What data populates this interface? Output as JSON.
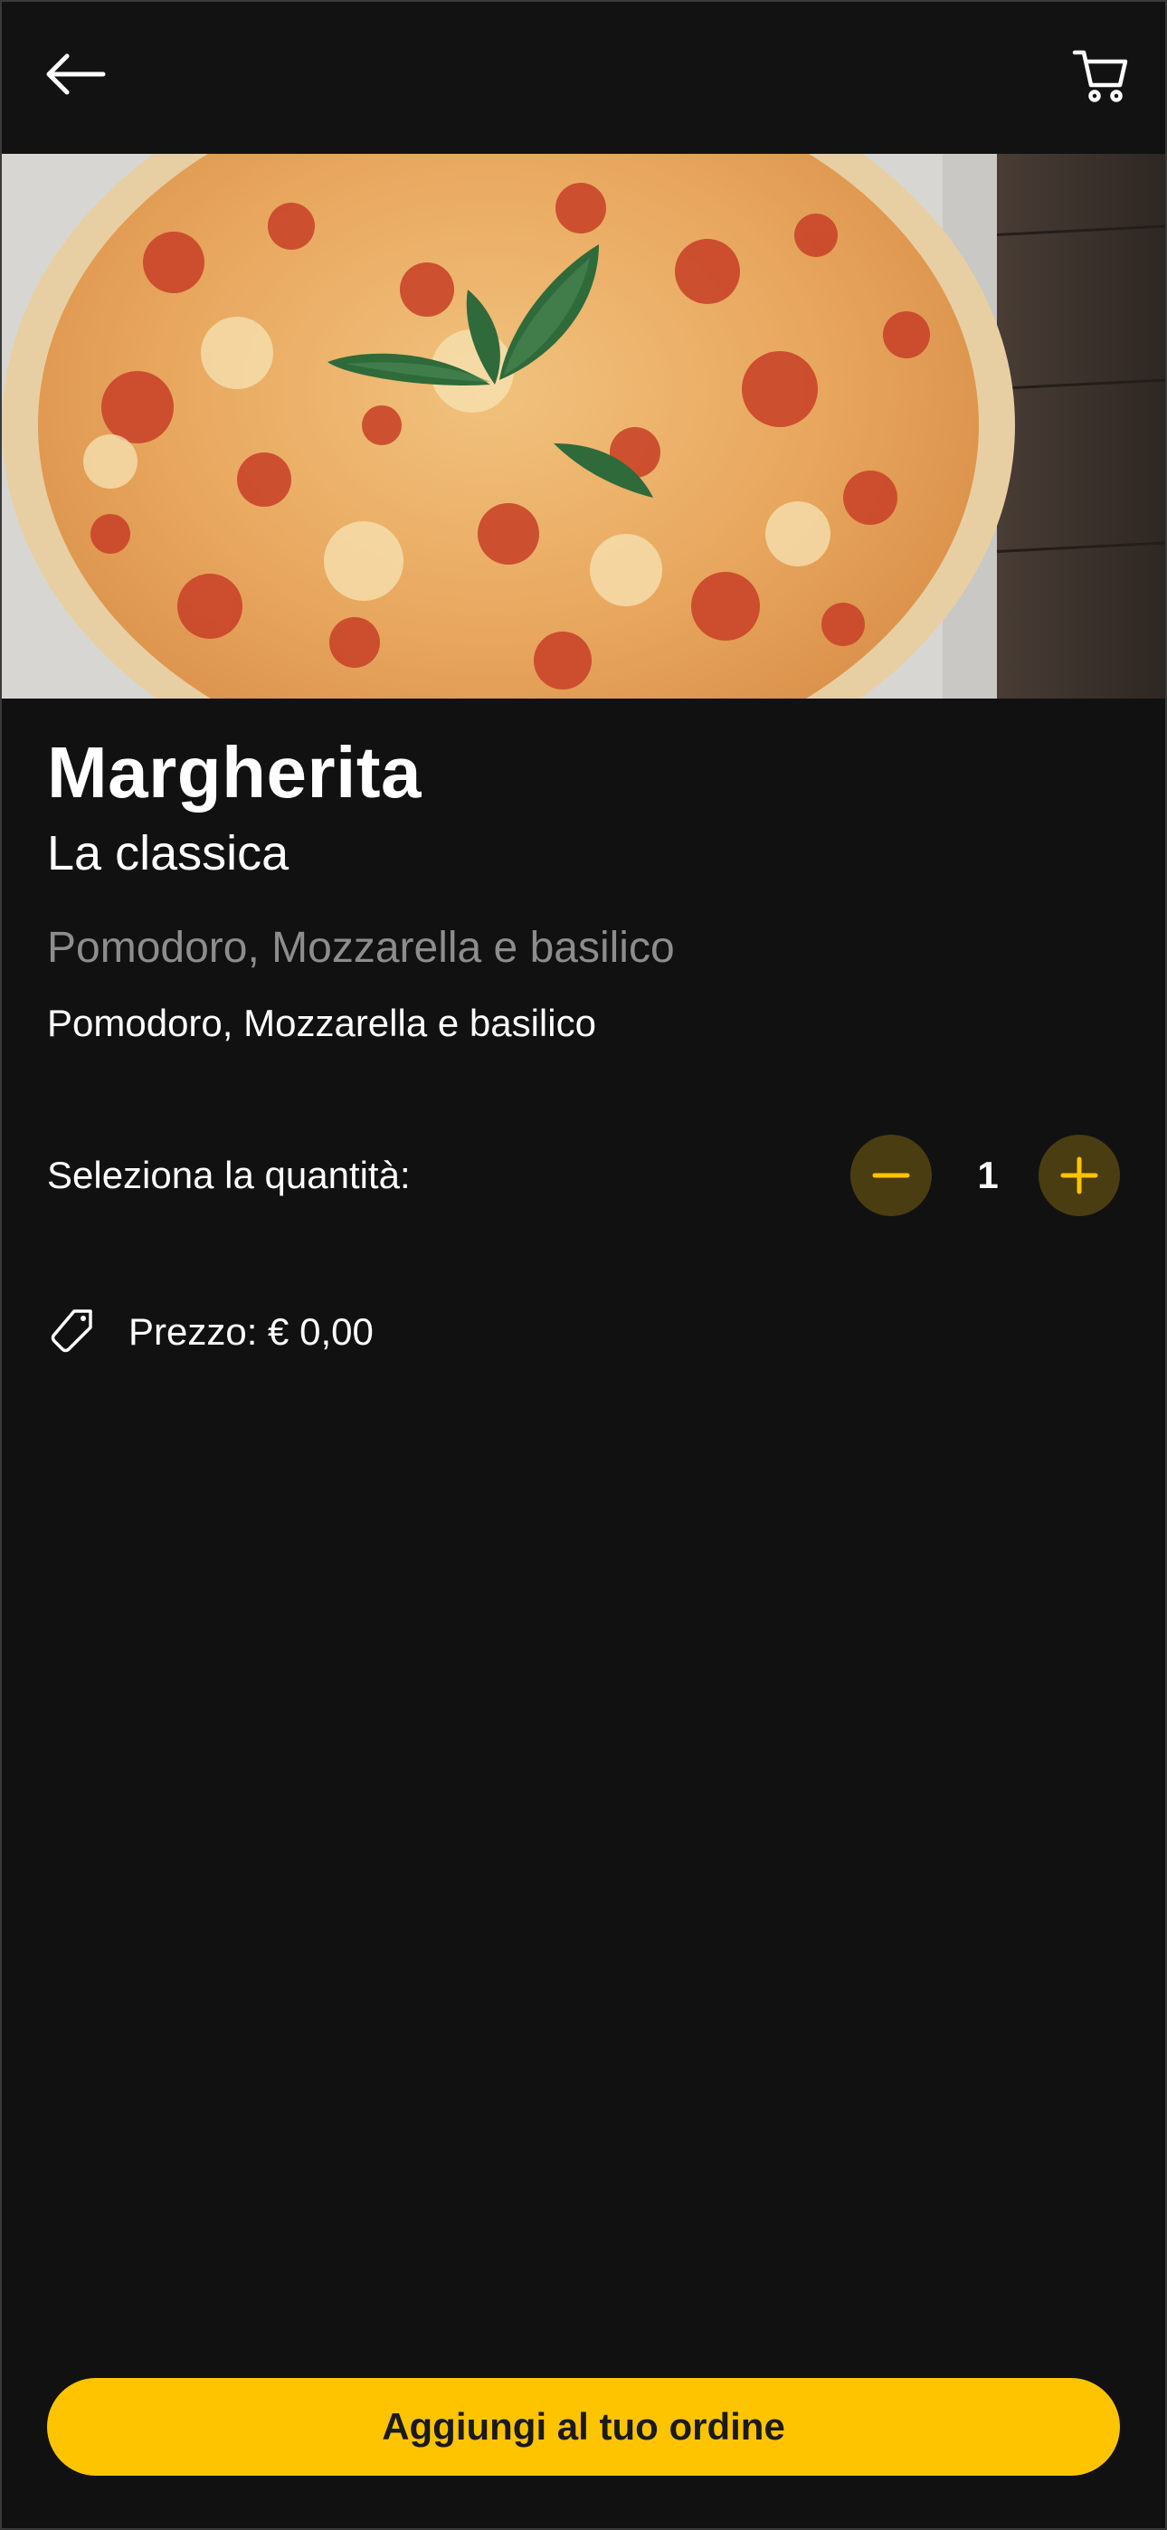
{
  "colors": {
    "background": "#111111",
    "accent": "#ffc400",
    "qty_button_bg": "#4b3d12",
    "muted_text": "#8d8d8d"
  },
  "header": {
    "back_icon": "arrow-left-icon",
    "cart_icon": "cart-icon"
  },
  "hero": {
    "image": "pizza-margherita-photo"
  },
  "product": {
    "name": "Margherita",
    "subtitle": "La classica",
    "description_muted": "Pomodoro, Mozzarella e basilico",
    "description": "Pomodoro, Mozzarella e basilico"
  },
  "quantity": {
    "label": "Seleziona la quantità:",
    "value": "1",
    "minus_icon": "minus-icon",
    "plus_icon": "plus-icon"
  },
  "price": {
    "icon": "price-tag-icon",
    "text": "Prezzo: € 0,00"
  },
  "cta": {
    "label": "Aggiungi al tuo ordine"
  }
}
